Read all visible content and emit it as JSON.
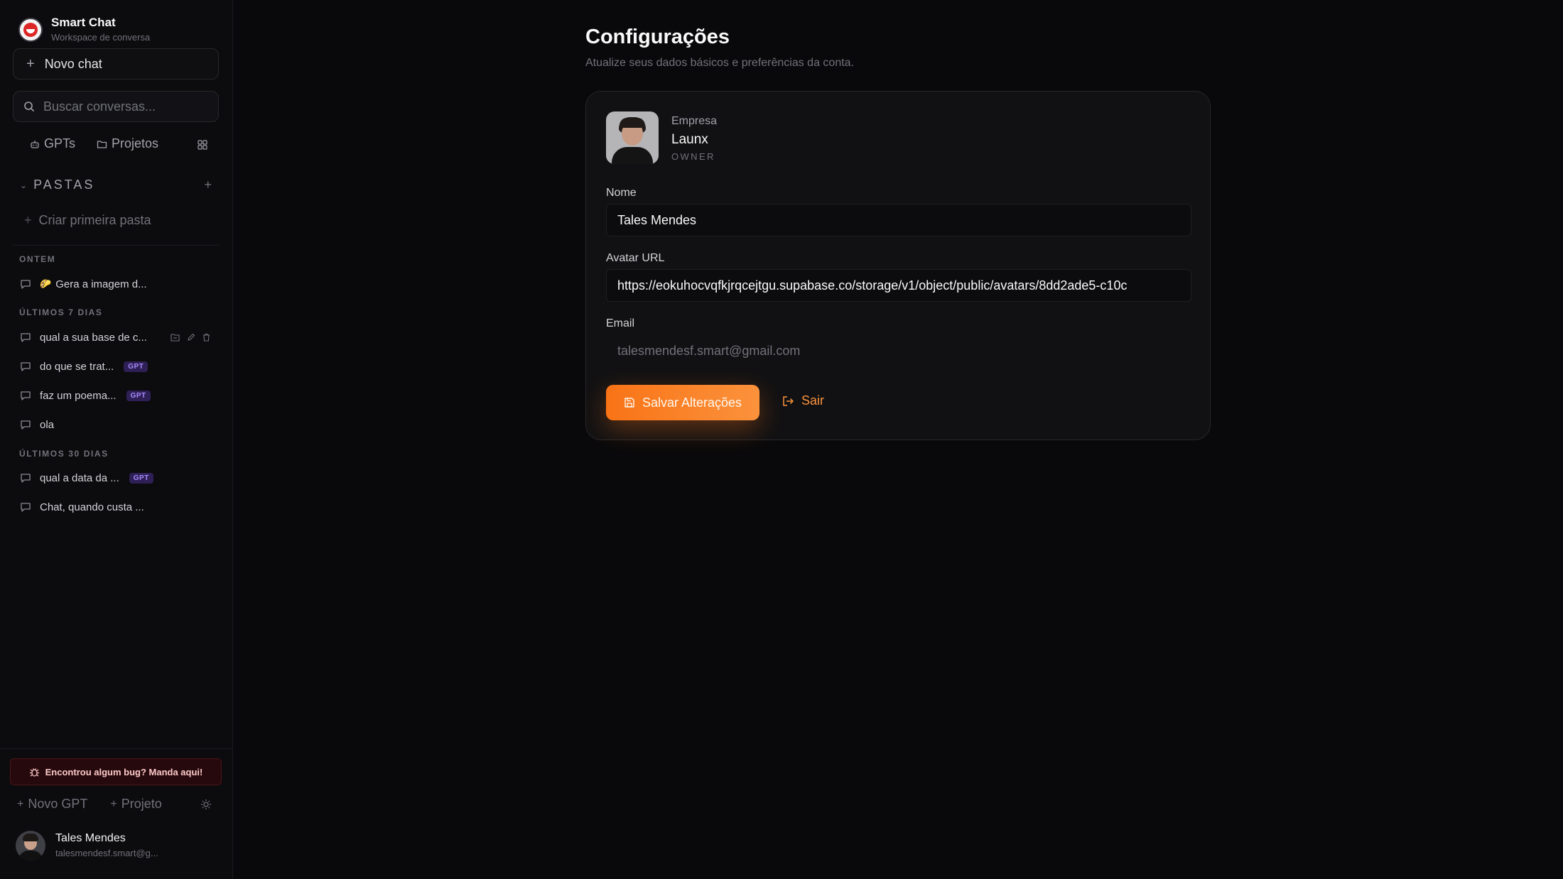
{
  "brand": {
    "title": "Smart Chat",
    "subtitle": "Workspace de conversa"
  },
  "sidebar": {
    "new_chat_label": "Novo chat",
    "search_placeholder": "Buscar conversas...",
    "tabs": [
      {
        "label": "GPTs",
        "icon": "bot-icon"
      },
      {
        "label": "Projetos",
        "icon": "folder-icon"
      }
    ],
    "folders_label": "PASTAS",
    "create_folder_label": "Criar primeira pasta",
    "groups": [
      {
        "label": "ONTEM",
        "items": [
          {
            "emoji": "🌮",
            "title": "Gera a imagem d...",
            "badge": ""
          }
        ]
      },
      {
        "label": "ÚLTIMOS 7 DIAS",
        "items": [
          {
            "title": "qual a sua base de c...",
            "badge": ""
          },
          {
            "title": "do que se trat...",
            "badge": "GPT"
          },
          {
            "title": "faz um poema...",
            "badge": "GPT"
          },
          {
            "title": "ola",
            "badge": ""
          }
        ]
      },
      {
        "label": "ÚLTIMOS 30 DIAS",
        "items": [
          {
            "title": "qual a data da ...",
            "badge": "GPT"
          },
          {
            "title": "Chat, quando custa ...",
            "badge": ""
          }
        ]
      }
    ],
    "bug_report_label": "Encontrou algum bug? Manda aqui!",
    "new_gpt_label": "Novo GPT",
    "new_project_label": "Projeto",
    "user": {
      "name": "Tales Mendes",
      "email": "talesmendesf.smart@g..."
    }
  },
  "main": {
    "title": "Configurações",
    "subtitle": "Atualize seus dados básicos e preferências da conta.",
    "company": {
      "label": "Empresa",
      "name": "Launx",
      "role": "OWNER"
    },
    "fields": {
      "name_label": "Nome",
      "name_value": "Tales Mendes",
      "avatar_label": "Avatar URL",
      "avatar_value": "https://eokuhocvqfkjrqcejtgu.supabase.co/storage/v1/object/public/avatars/8dd2ade5-c10c",
      "email_label": "Email",
      "email_value": "talesmendesf.smart@gmail.com"
    },
    "save_label": "Salvar Alterações",
    "logout_label": "Sair"
  },
  "colors": {
    "accent": "#f97316",
    "background": "#09090b",
    "badge": "#a78bfa"
  }
}
